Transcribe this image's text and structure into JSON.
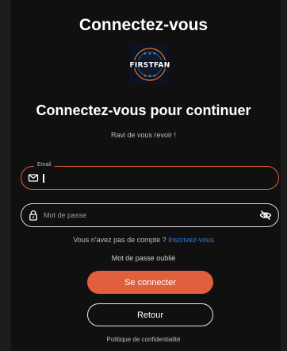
{
  "page": {
    "title": "Connectez-vous",
    "subtitle": "Connectez-vous pour continuer",
    "welcome": "Ravi de vous revoir !"
  },
  "logo": {
    "text": "FIRSTFAN",
    "colors": {
      "background": "#0b1322",
      "accent": "#e8712e",
      "stars": "#3aa0d8"
    }
  },
  "form": {
    "email": {
      "label": "Email",
      "value": "",
      "placeholder": "",
      "icon": "envelope-icon"
    },
    "password": {
      "label": "",
      "value": "",
      "placeholder": "Mot de passe",
      "icon": "lock-icon",
      "toggle_icon": "eye-off-icon"
    }
  },
  "links": {
    "signup_prompt": "Vous n'avez pas de compte ?",
    "signup_link": "Inscrivez-vous",
    "forgot_password": "Mot de passe oublié",
    "privacy": "Politique de confidentialité"
  },
  "buttons": {
    "login": "Se connecter",
    "back": "Retour"
  },
  "colors": {
    "accent": "#e0603d",
    "background": "#101010",
    "link": "#2f7fe8"
  }
}
